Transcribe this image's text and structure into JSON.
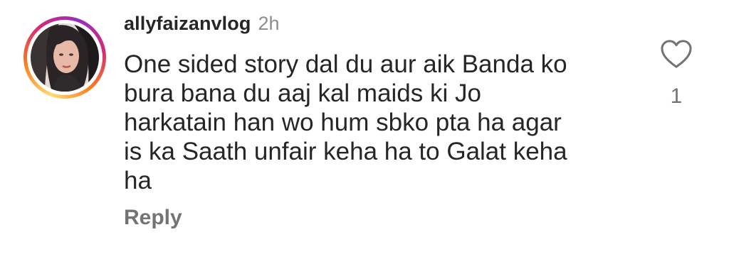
{
  "comment": {
    "username": "allyfaizanvlog",
    "timestamp": "2h",
    "text": "One sided story dal du aur aik Banda ko\nbura bana du aaj kal maids ki Jo\nharkatain han wo hum sbko pta ha agar\nis ka Saath unfair keha ha to Galat keha\nha",
    "reply_label": "Reply",
    "like_count": "1",
    "icons": {
      "like": "heart-outline-icon"
    },
    "colors": {
      "text": "#262626",
      "muted": "#8e8e8e",
      "ring_start": "#feda75",
      "ring_mid": "#d62976",
      "ring_end": "#962fbf"
    }
  }
}
